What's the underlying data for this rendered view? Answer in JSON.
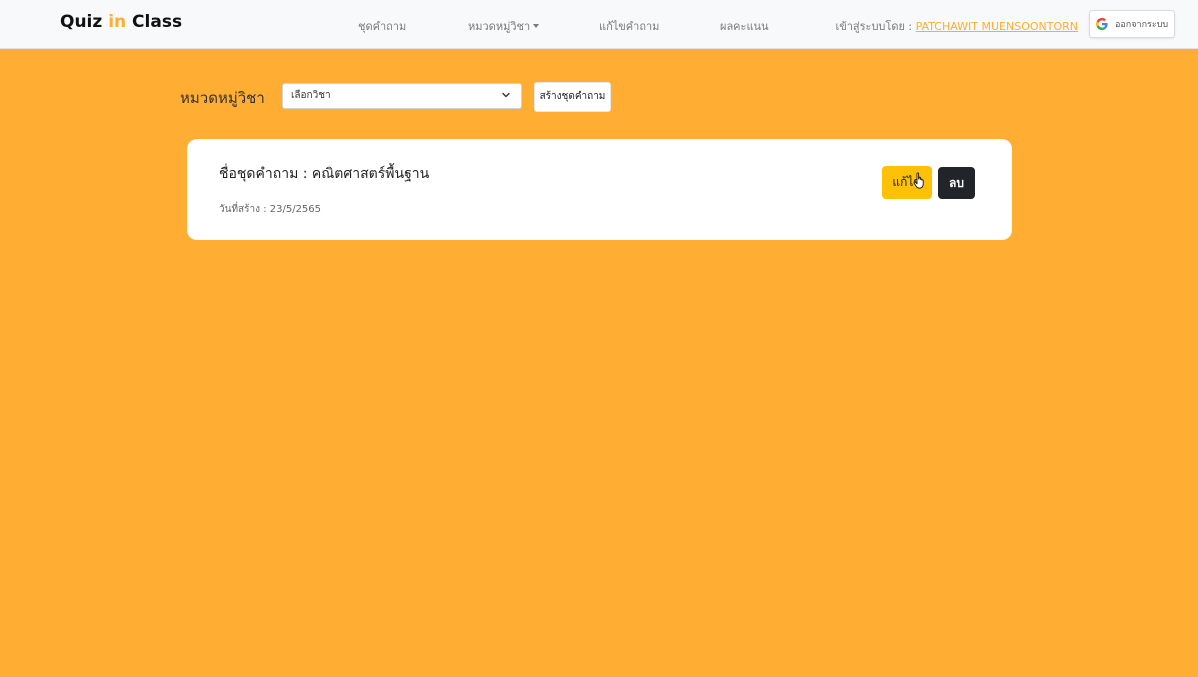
{
  "navbar": {
    "brand_part1": "Quiz ",
    "brand_accent": "in",
    "brand_part2": " Class",
    "links": [
      {
        "label": "ชุดคำถาม"
      },
      {
        "label": "หมวดหมู่วิชา",
        "has_dropdown": true
      },
      {
        "label": "แก้ไขคำถาม"
      },
      {
        "label": "ผลคะแนน"
      }
    ],
    "login_prefix": "เข้าสู่ระบบโดย : ",
    "user_name": "PATCHAWIT MUENSOONTORN",
    "logout_label": "ออกจากระบบ",
    "logout_icon": "google-icon"
  },
  "toolbar": {
    "subject_label": "หมวดหมู่วิชา",
    "select_value": "เลือกวิชา",
    "create_label": "สร้างชุดคำถาม"
  },
  "quiz_card": {
    "title": "ชื่อชุดคำถาม : คณิตศาสตร์พื้นฐาน",
    "created_date": "วันที่สร้าง : 23/5/2565",
    "edit_label": "แก้ไข",
    "delete_label": "ลบ"
  },
  "colors": {
    "accent": "#ffad33",
    "edit_button": "#ffc107",
    "delete_button": "#212529"
  }
}
